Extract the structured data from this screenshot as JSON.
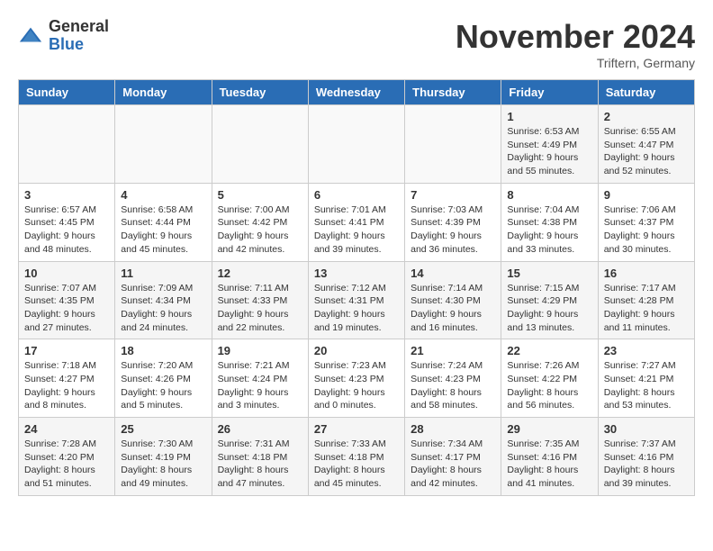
{
  "header": {
    "logo_general": "General",
    "logo_blue": "Blue",
    "month_title": "November 2024",
    "location": "Triftern, Germany"
  },
  "calendar": {
    "days_of_week": [
      "Sunday",
      "Monday",
      "Tuesday",
      "Wednesday",
      "Thursday",
      "Friday",
      "Saturday"
    ],
    "weeks": [
      [
        {
          "day": "",
          "info": ""
        },
        {
          "day": "",
          "info": ""
        },
        {
          "day": "",
          "info": ""
        },
        {
          "day": "",
          "info": ""
        },
        {
          "day": "",
          "info": ""
        },
        {
          "day": "1",
          "info": "Sunrise: 6:53 AM\nSunset: 4:49 PM\nDaylight: 9 hours\nand 55 minutes."
        },
        {
          "day": "2",
          "info": "Sunrise: 6:55 AM\nSunset: 4:47 PM\nDaylight: 9 hours\nand 52 minutes."
        }
      ],
      [
        {
          "day": "3",
          "info": "Sunrise: 6:57 AM\nSunset: 4:45 PM\nDaylight: 9 hours\nand 48 minutes."
        },
        {
          "day": "4",
          "info": "Sunrise: 6:58 AM\nSunset: 4:44 PM\nDaylight: 9 hours\nand 45 minutes."
        },
        {
          "day": "5",
          "info": "Sunrise: 7:00 AM\nSunset: 4:42 PM\nDaylight: 9 hours\nand 42 minutes."
        },
        {
          "day": "6",
          "info": "Sunrise: 7:01 AM\nSunset: 4:41 PM\nDaylight: 9 hours\nand 39 minutes."
        },
        {
          "day": "7",
          "info": "Sunrise: 7:03 AM\nSunset: 4:39 PM\nDaylight: 9 hours\nand 36 minutes."
        },
        {
          "day": "8",
          "info": "Sunrise: 7:04 AM\nSunset: 4:38 PM\nDaylight: 9 hours\nand 33 minutes."
        },
        {
          "day": "9",
          "info": "Sunrise: 7:06 AM\nSunset: 4:37 PM\nDaylight: 9 hours\nand 30 minutes."
        }
      ],
      [
        {
          "day": "10",
          "info": "Sunrise: 7:07 AM\nSunset: 4:35 PM\nDaylight: 9 hours\nand 27 minutes."
        },
        {
          "day": "11",
          "info": "Sunrise: 7:09 AM\nSunset: 4:34 PM\nDaylight: 9 hours\nand 24 minutes."
        },
        {
          "day": "12",
          "info": "Sunrise: 7:11 AM\nSunset: 4:33 PM\nDaylight: 9 hours\nand 22 minutes."
        },
        {
          "day": "13",
          "info": "Sunrise: 7:12 AM\nSunset: 4:31 PM\nDaylight: 9 hours\nand 19 minutes."
        },
        {
          "day": "14",
          "info": "Sunrise: 7:14 AM\nSunset: 4:30 PM\nDaylight: 9 hours\nand 16 minutes."
        },
        {
          "day": "15",
          "info": "Sunrise: 7:15 AM\nSunset: 4:29 PM\nDaylight: 9 hours\nand 13 minutes."
        },
        {
          "day": "16",
          "info": "Sunrise: 7:17 AM\nSunset: 4:28 PM\nDaylight: 9 hours\nand 11 minutes."
        }
      ],
      [
        {
          "day": "17",
          "info": "Sunrise: 7:18 AM\nSunset: 4:27 PM\nDaylight: 9 hours\nand 8 minutes."
        },
        {
          "day": "18",
          "info": "Sunrise: 7:20 AM\nSunset: 4:26 PM\nDaylight: 9 hours\nand 5 minutes."
        },
        {
          "day": "19",
          "info": "Sunrise: 7:21 AM\nSunset: 4:24 PM\nDaylight: 9 hours\nand 3 minutes."
        },
        {
          "day": "20",
          "info": "Sunrise: 7:23 AM\nSunset: 4:23 PM\nDaylight: 9 hours\nand 0 minutes."
        },
        {
          "day": "21",
          "info": "Sunrise: 7:24 AM\nSunset: 4:23 PM\nDaylight: 8 hours\nand 58 minutes."
        },
        {
          "day": "22",
          "info": "Sunrise: 7:26 AM\nSunset: 4:22 PM\nDaylight: 8 hours\nand 56 minutes."
        },
        {
          "day": "23",
          "info": "Sunrise: 7:27 AM\nSunset: 4:21 PM\nDaylight: 8 hours\nand 53 minutes."
        }
      ],
      [
        {
          "day": "24",
          "info": "Sunrise: 7:28 AM\nSunset: 4:20 PM\nDaylight: 8 hours\nand 51 minutes."
        },
        {
          "day": "25",
          "info": "Sunrise: 7:30 AM\nSunset: 4:19 PM\nDaylight: 8 hours\nand 49 minutes."
        },
        {
          "day": "26",
          "info": "Sunrise: 7:31 AM\nSunset: 4:18 PM\nDaylight: 8 hours\nand 47 minutes."
        },
        {
          "day": "27",
          "info": "Sunrise: 7:33 AM\nSunset: 4:18 PM\nDaylight: 8 hours\nand 45 minutes."
        },
        {
          "day": "28",
          "info": "Sunrise: 7:34 AM\nSunset: 4:17 PM\nDaylight: 8 hours\nand 42 minutes."
        },
        {
          "day": "29",
          "info": "Sunrise: 7:35 AM\nSunset: 4:16 PM\nDaylight: 8 hours\nand 41 minutes."
        },
        {
          "day": "30",
          "info": "Sunrise: 7:37 AM\nSunset: 4:16 PM\nDaylight: 8 hours\nand 39 minutes."
        }
      ]
    ]
  }
}
